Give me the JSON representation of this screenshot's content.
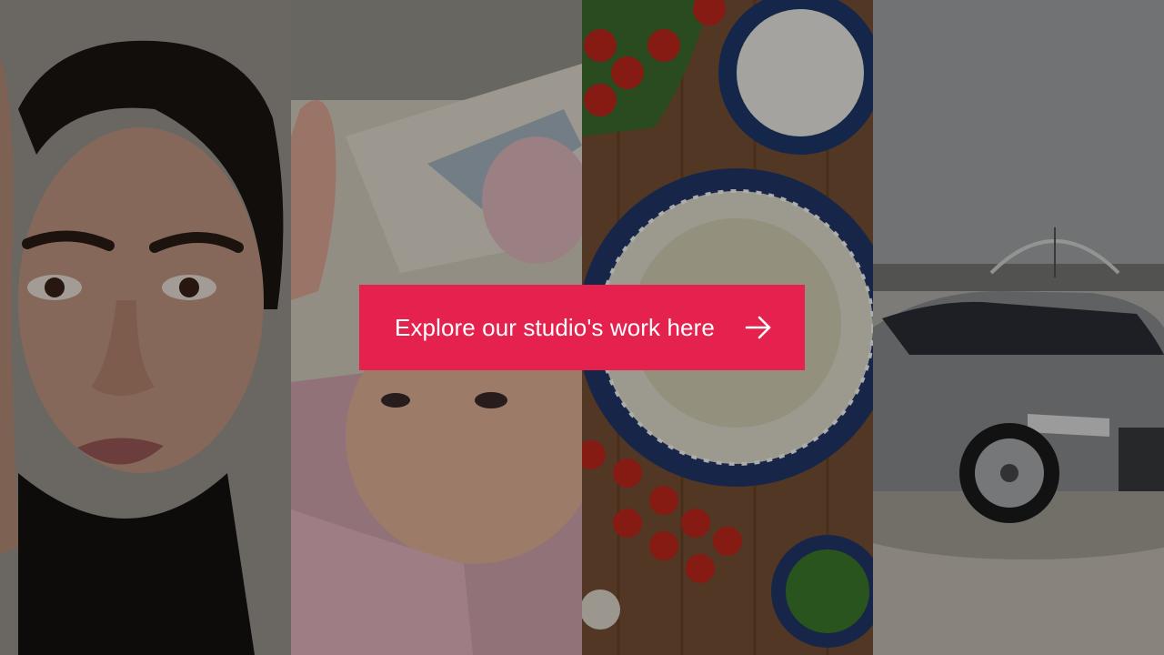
{
  "hero": {
    "panels": [
      {
        "name": "portrait-woman-image"
      },
      {
        "name": "baby-image"
      },
      {
        "name": "food-flatlay-image"
      },
      {
        "name": "car-image"
      }
    ],
    "cta": {
      "label": "Explore our studio's work here",
      "icon": "arrow-right-icon",
      "background_color": "#e5214d",
      "text_color": "#ffffff"
    }
  }
}
